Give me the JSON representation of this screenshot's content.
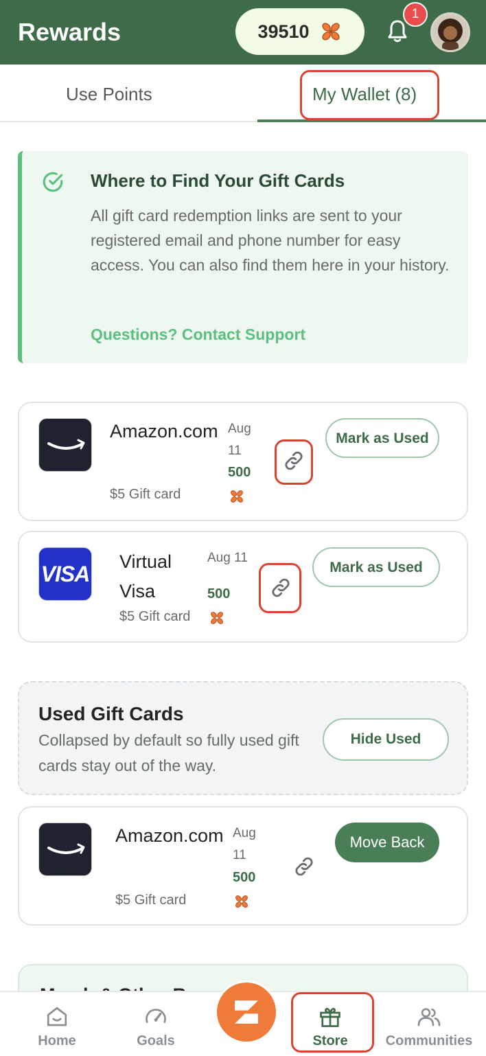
{
  "header": {
    "title": "Rewards",
    "points": "39510",
    "notification_count": "1"
  },
  "tabs": [
    {
      "label": "Use Points",
      "active": false
    },
    {
      "label": "My Wallet (8)",
      "active": true
    }
  ],
  "info": {
    "title": "Where to Find Your Gift Cards",
    "body": "All gift card redemption links are sent to your registered email and phone number for easy access. You can also find them here in your history.",
    "link": "Questions? Contact Support"
  },
  "active_cards": [
    {
      "brand": "Amazon.com",
      "subtitle": "$5 Gift card",
      "date": "Aug 11",
      "points": "500",
      "action": "Mark as Used"
    },
    {
      "brand": "Virtual Visa",
      "subtitle": "$5 Gift card",
      "date": "Aug 11",
      "points": "500",
      "action": "Mark as Used"
    }
  ],
  "used_section": {
    "title": "Used Gift Cards",
    "body": "Collapsed by default so fully used gift cards stay out of the way.",
    "button": "Hide Used"
  },
  "used_cards": [
    {
      "brand": "Amazon.com",
      "subtitle": "$5 Gift card",
      "date": "Aug 11",
      "points": "500",
      "action": "Move Back"
    }
  ],
  "next_section": {
    "title": "Merch & Other Re..."
  },
  "visa_logo_text": "VISA",
  "nav": [
    {
      "label": "Home",
      "icon": "home-icon"
    },
    {
      "label": "Goals",
      "icon": "gauge-icon"
    },
    {
      "label": "Store",
      "icon": "gift-icon",
      "active": true
    },
    {
      "label": "Communities",
      "icon": "people-icon"
    }
  ],
  "colors": {
    "brand_green": "#3e6b48",
    "accent_green": "#5cbf7f",
    "accent_orange": "#ef7b3a",
    "highlight_red": "#d94430"
  }
}
